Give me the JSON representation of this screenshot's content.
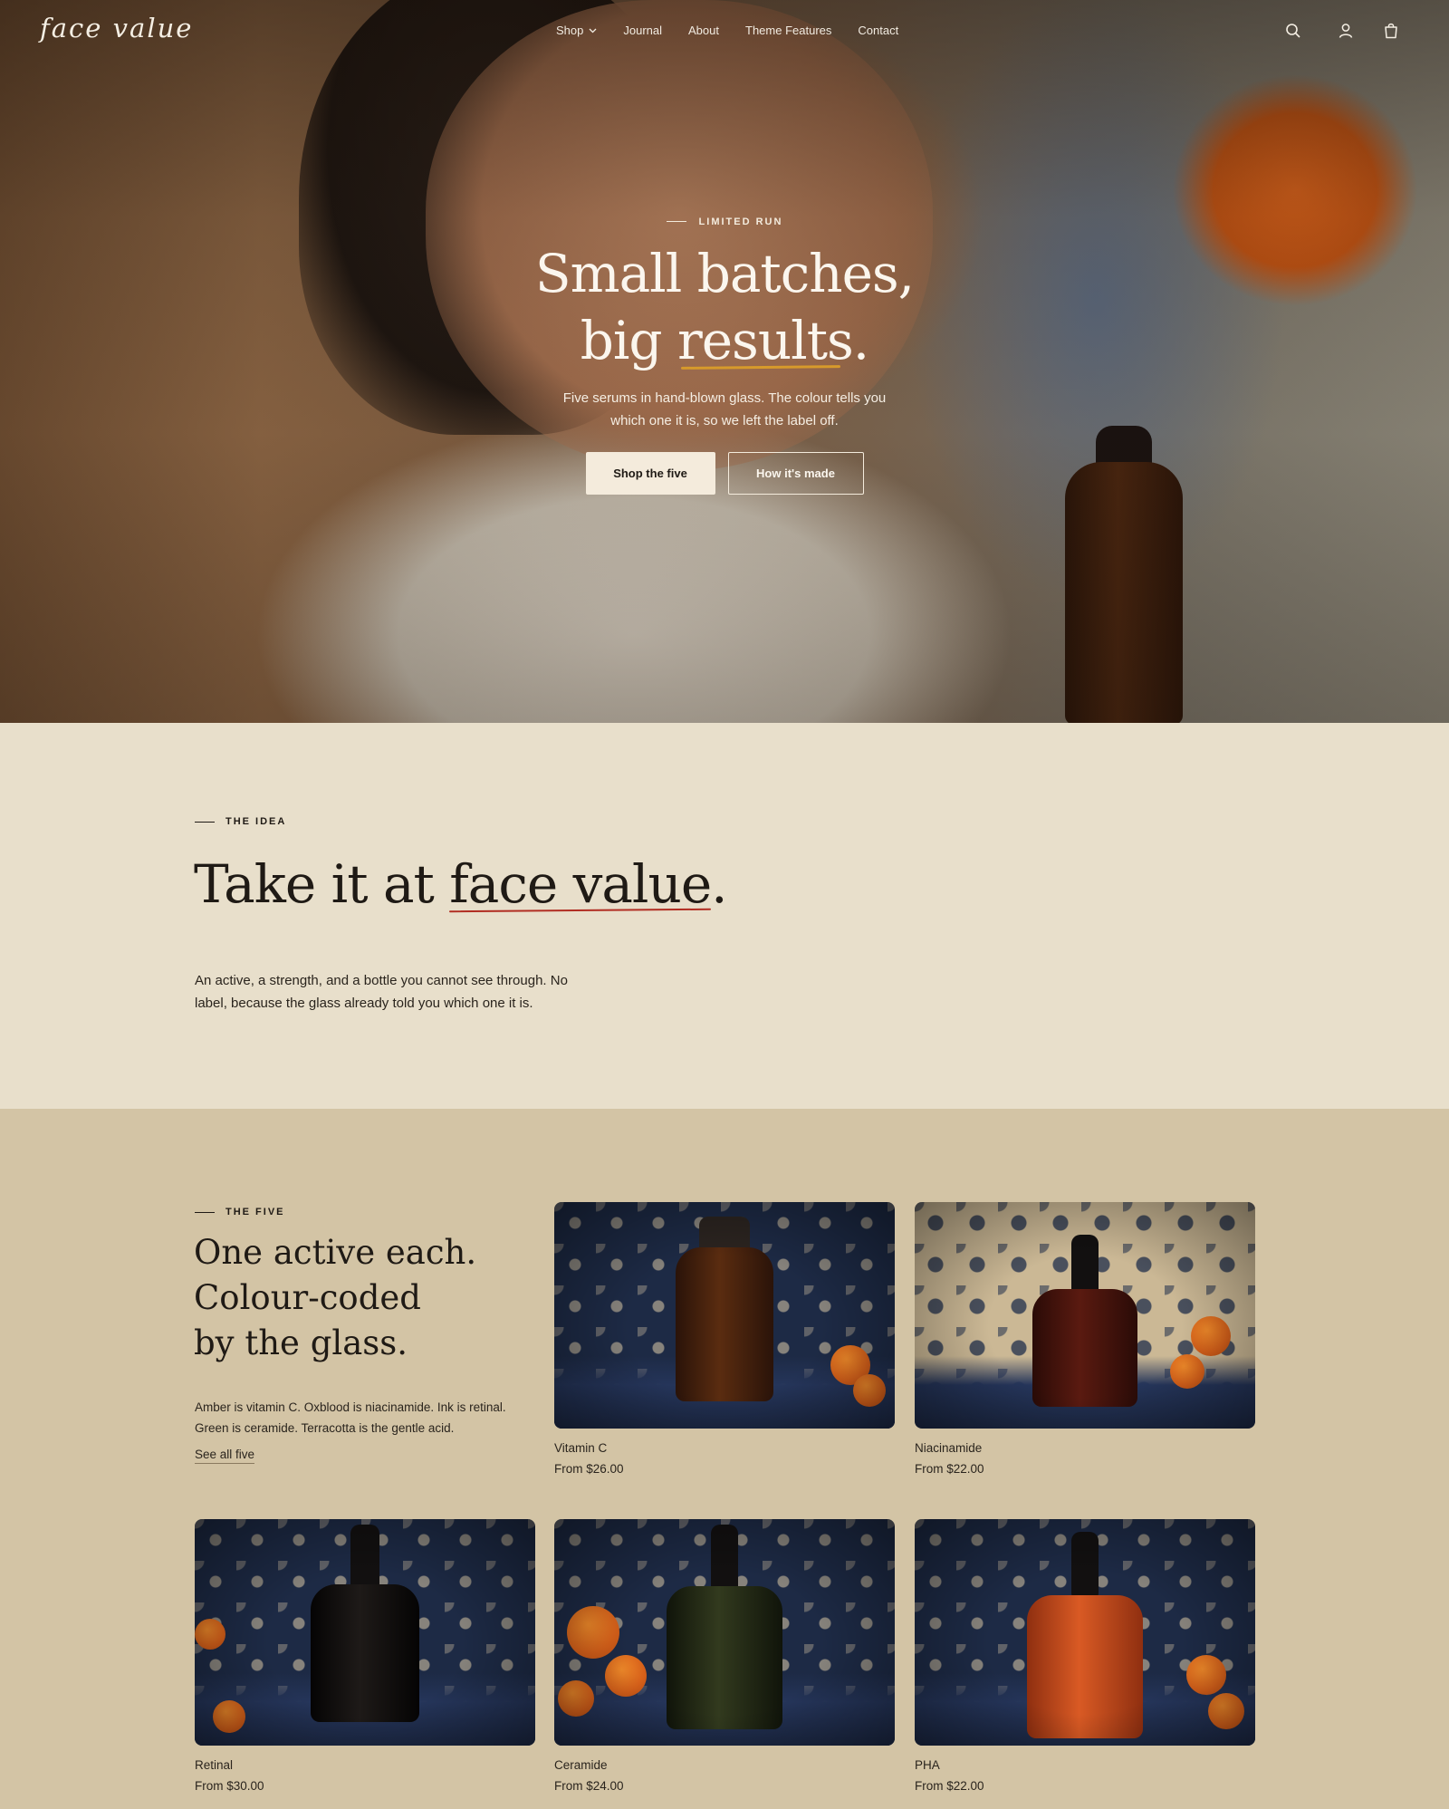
{
  "nav": {
    "logo": "face value",
    "menu": [
      "Shop",
      "Journal",
      "About",
      "Theme Features",
      "Contact"
    ]
  },
  "hero": {
    "eyebrow": "LIMITED RUN",
    "title_line1": "Small batches,",
    "title_line2_pre": "big ",
    "title_line2_u": "results",
    "title_line2_post": ".",
    "subtitle": "Five serums in hand-blown glass. The colour tells you which one it is, so we left the label off.",
    "btn_primary": "Shop the five",
    "btn_secondary": "How it's made"
  },
  "idea": {
    "eyebrow": "THE IDEA",
    "title_pre": "Take it at ",
    "title_u": "face value",
    "title_post": ".",
    "body": "An active, a strength, and a bottle you cannot see through. No label, because the glass already told you which one it is."
  },
  "five": {
    "eyebrow": "THE FIVE",
    "title_line1": "One active each.",
    "title_line2": "Colour-coded",
    "title_line3": "by the glass.",
    "body": "Amber is vitamin C. Oxblood is niacinamide. Ink is retinal. Green is ceramide. Terracotta is the gentle acid.",
    "see_all": "See all five",
    "products": [
      {
        "name": "Vitamin C",
        "price": "From $26.00",
        "glass": "#4a2410"
      },
      {
        "name": "Niacinamide",
        "price": "From $22.00",
        "glass": "#3d130c"
      },
      {
        "name": "Retinal",
        "price": "From $30.00",
        "glass": "#0e0b0a"
      },
      {
        "name": "Ceramide",
        "price": "From $24.00",
        "glass": "#1f2413"
      },
      {
        "name": "PHA",
        "price": "From $22.00",
        "glass": "#c0461b"
      }
    ]
  },
  "colors": {
    "cream_bg": "#e8dfcb",
    "tan_bg": "#d3c4a5",
    "hero_underline": "#d79a2b",
    "idea_underline": "#b12d22"
  },
  "icons": [
    "search-icon",
    "account-icon",
    "cart-icon",
    "chevron-down-icon"
  ]
}
